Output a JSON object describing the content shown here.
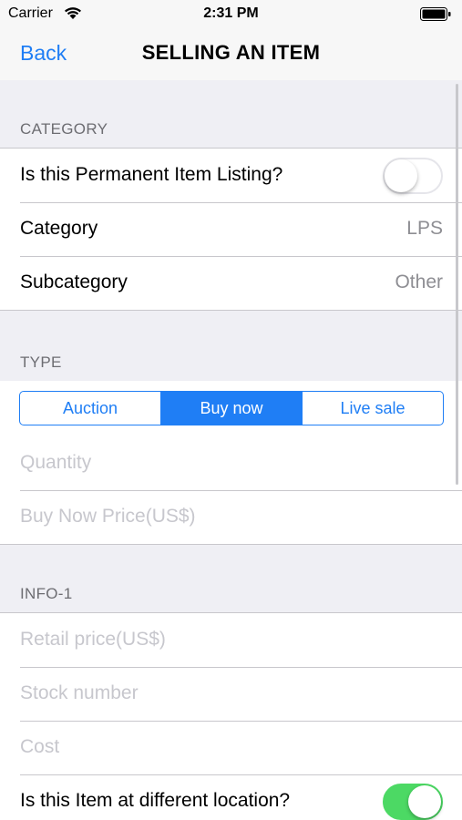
{
  "status_bar": {
    "carrier": "Carrier",
    "time": "2:31 PM",
    "wifi_icon": "wifi-icon",
    "battery_icon": "battery-icon"
  },
  "nav": {
    "back_label": "Back",
    "title": "SELLING AN ITEM"
  },
  "sections": {
    "category": {
      "header": "CATEGORY",
      "permanent_listing_label": "Is this Permanent Item Listing?",
      "permanent_listing_on": false,
      "category_label": "Category",
      "category_value": "LPS",
      "subcategory_label": "Subcategory",
      "subcategory_value": "Other"
    },
    "type": {
      "header": "TYPE",
      "segments": [
        "Auction",
        "Buy now",
        "Live sale"
      ],
      "selected_segment": "Buy now",
      "quantity_placeholder": "Quantity",
      "price_placeholder": "Buy Now Price(US$)"
    },
    "info1": {
      "header": "INFO-1",
      "retail_placeholder": "Retail price(US$)",
      "stock_placeholder": "Stock number",
      "cost_placeholder": "Cost",
      "different_location_label": "Is this Item at different location?",
      "different_location_on": true
    }
  },
  "colors": {
    "accent": "#1f7ef5",
    "toggle_on": "#4cd964",
    "background": "#efeff4",
    "placeholder": "#c7c7cd"
  }
}
